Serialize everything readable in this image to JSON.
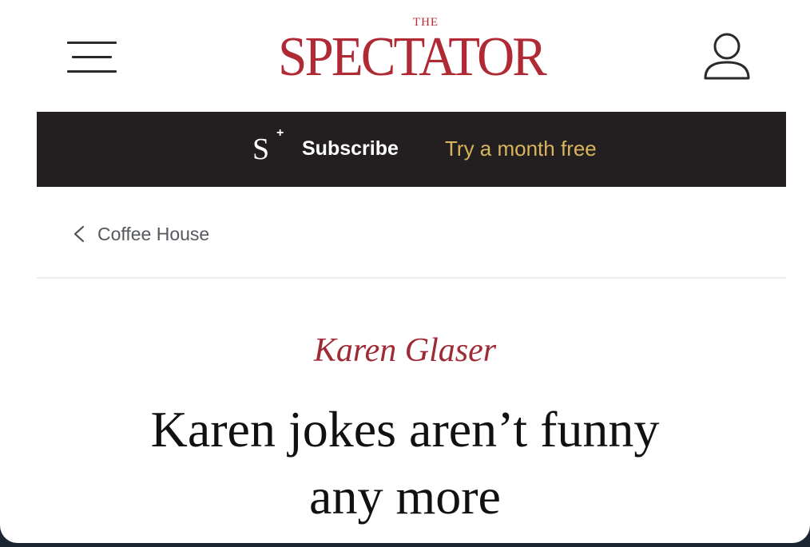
{
  "header": {
    "menu_icon": "hamburger-menu-icon",
    "logo_small": "THE",
    "logo_main": "SPECTATOR",
    "account_icon": "user-account-icon",
    "brand_color": "#b02a35"
  },
  "subscribe_bar": {
    "badge_letter": "S",
    "badge_plus": "+",
    "label": "Subscribe",
    "offer": "Try a month free",
    "background": "#231f20",
    "offer_color": "#d8b45c"
  },
  "breadcrumb": {
    "icon": "chevron-left-icon",
    "label": "Coffee House"
  },
  "article": {
    "author": "Karen Glaser",
    "headline_line1": "Karen jokes aren’t funny",
    "headline_line2": "any more"
  }
}
